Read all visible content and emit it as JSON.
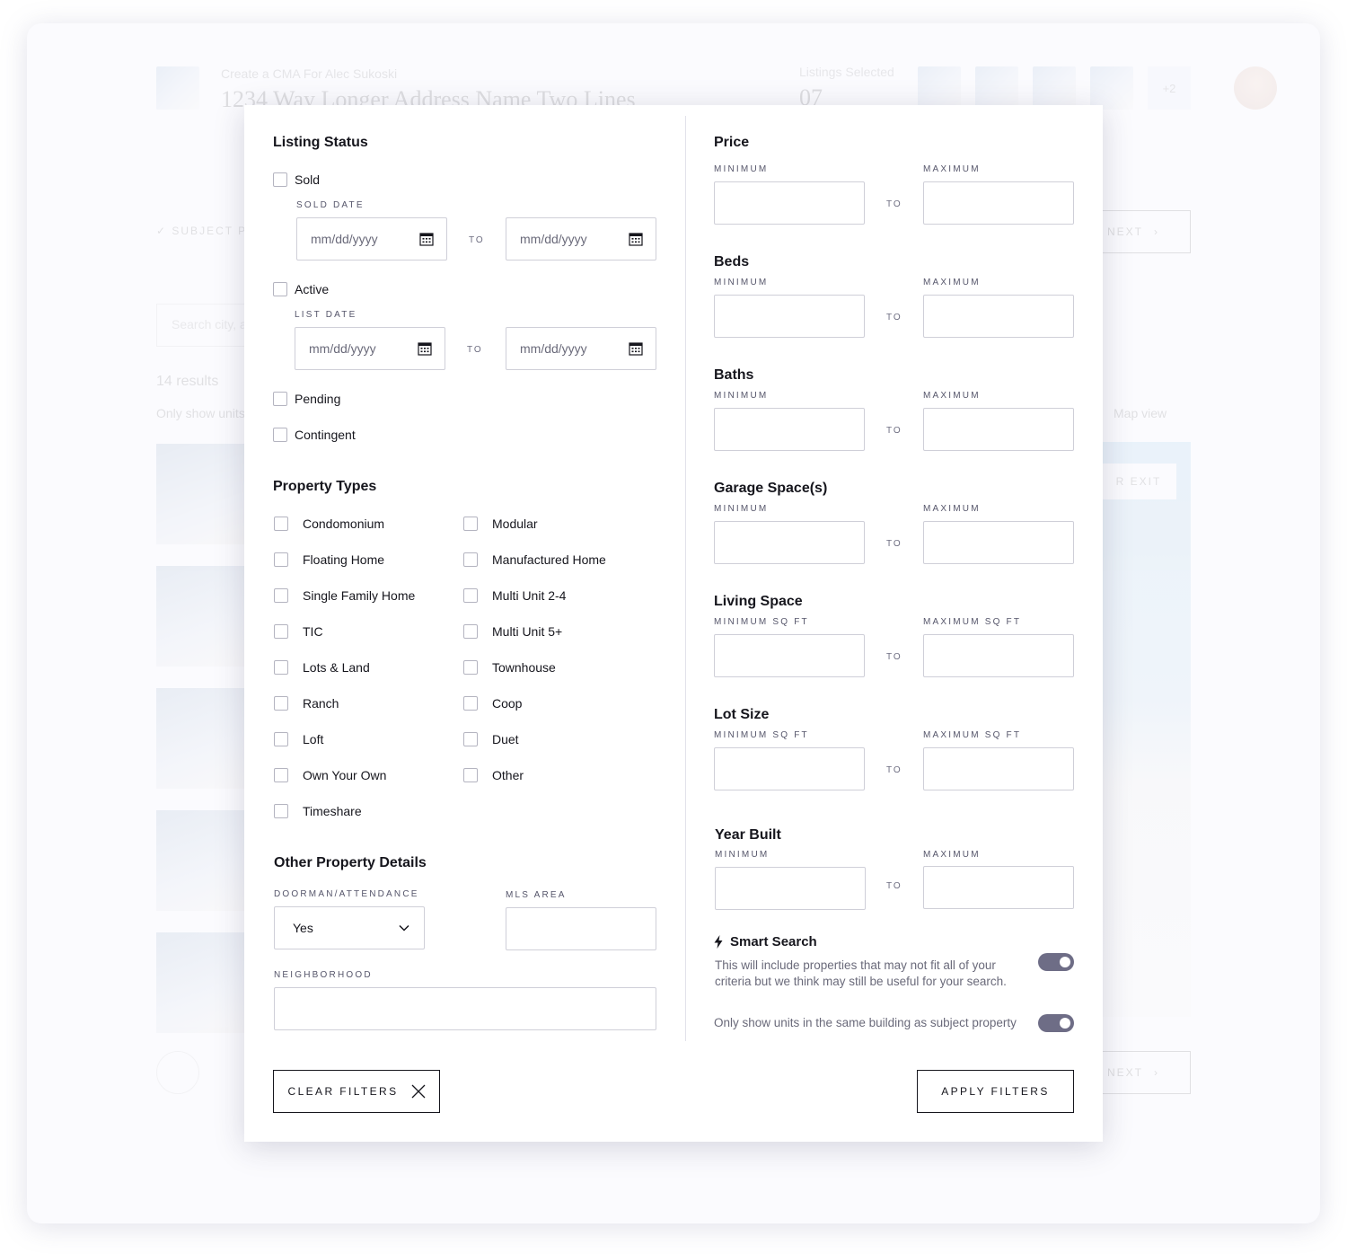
{
  "background": {
    "crumb": "Create a CMA For Alec Sukoski",
    "address": "1234 Way Longer Address Name Two Lines",
    "listings_selected_label": "Listings Selected",
    "listings_selected_count": "07",
    "more_listings_badge": "+2",
    "subject_step": "✓ SUBJECT P",
    "next_label": "NEXT",
    "search_placeholder": "Search city, a",
    "results_count": "14 results",
    "only_units_text": "Only show units",
    "map_view_label": "Map view",
    "exit_label": "R   EXIT"
  },
  "listing_status": {
    "heading": "Listing Status",
    "sold_label": "Sold",
    "sold_date_label": "SOLD DATE",
    "active_label": "Active",
    "list_date_label": "LIST DATE",
    "pending_label": "Pending",
    "contingent_label": "Contingent",
    "date_placeholder": "mm/dd/yyyy",
    "to_label": "TO"
  },
  "property_types": {
    "heading": "Property Types",
    "left": [
      "Condomonium",
      "Floating Home",
      "Single Family Home",
      "TIC",
      "Lots & Land",
      "Ranch",
      "Loft",
      "Own Your Own",
      "Timeshare"
    ],
    "right": [
      "Modular",
      "Manufactured Home",
      "Multi Unit 2-4",
      "Multi Unit 5+",
      "Townhouse",
      "Coop",
      "Duet",
      "Other"
    ]
  },
  "other_details": {
    "heading": "Other Property Details",
    "doorman_label": "DOORMAN/ATTENDANCE",
    "doorman_value": "Yes",
    "mls_area_label": "MLS AREA",
    "neighborhood_label": "NEIGHBORHOOD"
  },
  "ranges": {
    "min_label": "MINIMUM",
    "max_label": "MAXIMUM",
    "min_sqft_label": "MINIMUM SQ FT",
    "max_sqft_label": "MAXIMUM SQ FT",
    "to_label": "TO",
    "price": "Price",
    "beds": "Beds",
    "baths": "Baths",
    "garage": "Garage Space(s)",
    "living_space": "Living Space",
    "lot_size": "Lot Size",
    "year_built": "Year Built"
  },
  "smart_search": {
    "title": "Smart Search",
    "description": "This will include properties that may not fit all of your criteria but we think may still be useful for your search.",
    "enabled": true,
    "only_same_building_label": "Only show units in the same building as subject property",
    "only_same_building_enabled": true
  },
  "actions": {
    "clear_label": "CLEAR FILTERS",
    "apply_label": "APPLY FILTERS"
  },
  "colors": {
    "toggle_on": "#6e6d86",
    "text_primary": "#16161d",
    "text_muted": "#6a6a7a",
    "border": "#cfcfd8"
  },
  "icons": {
    "calendar": "calendar-icon",
    "chevron": "chevron-down-icon",
    "bolt": "lightning-icon",
    "close": "close-icon"
  }
}
